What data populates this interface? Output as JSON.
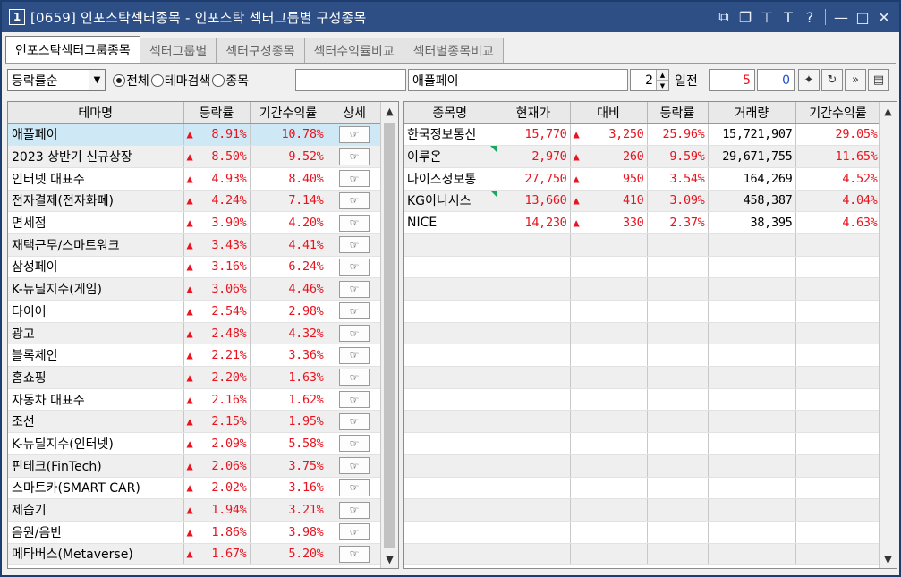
{
  "window": {
    "number_badge": "1",
    "title": "[0659] 인포스탁섹터종목 - 인포스탁 섹터그룹별 구성종목"
  },
  "title_controls": [
    {
      "icon": "link-icon",
      "glyph": "⧉"
    },
    {
      "icon": "copy-window-icon",
      "glyph": "❐"
    },
    {
      "icon": "pin-icon",
      "glyph": "⊤"
    },
    {
      "icon": "font-icon",
      "glyph": "T"
    },
    {
      "icon": "help-icon",
      "glyph": "?"
    },
    {
      "icon": "minimize-icon",
      "glyph": "—"
    },
    {
      "icon": "maximize-icon",
      "glyph": "□"
    },
    {
      "icon": "close-icon",
      "glyph": "✕"
    }
  ],
  "tabs": [
    {
      "label": "인포스탁섹터그룹종목",
      "active": true
    },
    {
      "label": "섹터그룹별"
    },
    {
      "label": "섹터구성종목"
    },
    {
      "label": "섹터수익률비교"
    },
    {
      "label": "섹터별종목비교"
    }
  ],
  "toolbar": {
    "sort_select": "등락률순",
    "radios": [
      {
        "label": "전체",
        "checked": true
      },
      {
        "label": "테마검색",
        "checked": false
      },
      {
        "label": "종목",
        "checked": false
      }
    ],
    "search_value": "",
    "theme_value": "애플페이",
    "days_value": "2",
    "days_label": "일전",
    "from_value": "5",
    "to_value": "0"
  },
  "left_table": {
    "headers": [
      "테마명",
      "등락률",
      "기간수익률",
      "상세"
    ],
    "rows": [
      {
        "name": "애플페이",
        "change": "8.91%",
        "period": "10.78%"
      },
      {
        "name": "2023 상반기 신규상장",
        "change": "8.50%",
        "period": "9.52%"
      },
      {
        "name": "인터넷 대표주",
        "change": "4.93%",
        "period": "8.40%"
      },
      {
        "name": "전자결제(전자화폐)",
        "change": "4.24%",
        "period": "7.14%"
      },
      {
        "name": "면세점",
        "change": "3.90%",
        "period": "4.20%"
      },
      {
        "name": "재택근무/스마트워크",
        "change": "3.43%",
        "period": "4.41%"
      },
      {
        "name": "삼성페이",
        "change": "3.16%",
        "period": "6.24%"
      },
      {
        "name": "K-뉴딜지수(게임)",
        "change": "3.06%",
        "period": "4.46%"
      },
      {
        "name": "타이어",
        "change": "2.54%",
        "period": "2.98%"
      },
      {
        "name": "광고",
        "change": "2.48%",
        "period": "4.32%"
      },
      {
        "name": "블록체인",
        "change": "2.21%",
        "period": "3.36%"
      },
      {
        "name": "홈쇼핑",
        "change": "2.20%",
        "period": "1.63%"
      },
      {
        "name": "자동차 대표주",
        "change": "2.16%",
        "period": "1.62%"
      },
      {
        "name": "조선",
        "change": "2.15%",
        "period": "1.95%"
      },
      {
        "name": "K-뉴딜지수(인터넷)",
        "change": "2.09%",
        "period": "5.58%"
      },
      {
        "name": "핀테크(FinTech)",
        "change": "2.06%",
        "period": "3.75%"
      },
      {
        "name": "스마트카(SMART CAR)",
        "change": "2.02%",
        "period": "3.16%"
      },
      {
        "name": "제습기",
        "change": "1.94%",
        "period": "3.21%"
      },
      {
        "name": "음원/음반",
        "change": "1.86%",
        "period": "3.98%"
      },
      {
        "name": "메타버스(Metaverse)",
        "change": "1.67%",
        "period": "5.20%"
      }
    ]
  },
  "right_table": {
    "headers": [
      "종목명",
      "현재가",
      "대비",
      "등락률",
      "거래량",
      "기간수익률"
    ],
    "rows": [
      {
        "name": "한국정보통신",
        "price": "15,770",
        "diff": "3,250",
        "change": "25.96%",
        "volume": "15,721,907",
        "period": "29.05%",
        "mark": false
      },
      {
        "name": "이루온",
        "price": "2,970",
        "diff": "260",
        "change": "9.59%",
        "volume": "29,671,755",
        "period": "11.65%",
        "mark": true
      },
      {
        "name": "나이스정보통",
        "price": "27,750",
        "diff": "950",
        "change": "3.54%",
        "volume": "164,269",
        "period": "4.52%",
        "mark": false
      },
      {
        "name": "KG이니시스",
        "price": "13,660",
        "diff": "410",
        "change": "3.09%",
        "volume": "458,387",
        "period": "4.04%",
        "mark": true
      },
      {
        "name": "NICE",
        "price": "14,230",
        "diff": "330",
        "change": "2.37%",
        "volume": "38,395",
        "period": "4.63%",
        "mark": false
      }
    ],
    "empty_rows": 15
  },
  "colors": {
    "up": "#e8141f",
    "titlebar": "#2d4f86",
    "selected_row": "#cfe8f5"
  }
}
